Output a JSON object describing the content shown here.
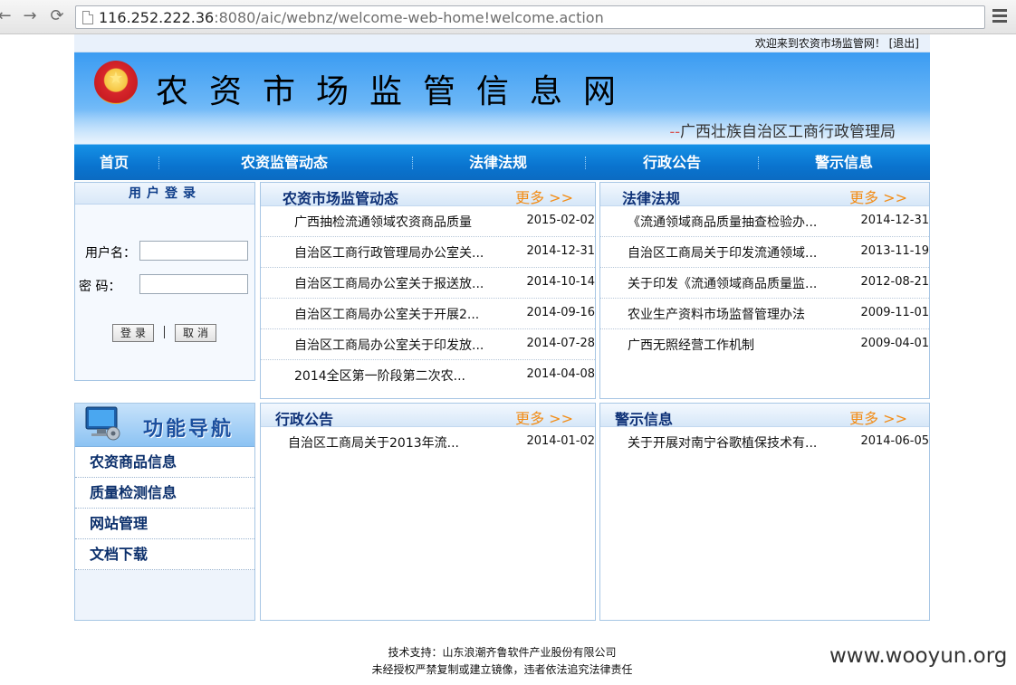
{
  "browser": {
    "back_icon": "←",
    "forward_icon": "→",
    "reload_icon": "⟳",
    "url_host": "116.252.222.36",
    "url_rest": ":8080/aic/webnz/welcome-web-home!welcome.action"
  },
  "header": {
    "welcome": "欢迎来到农资市场监管网！ [退出]",
    "site_title": "农资市场监管信息网",
    "agency_dash": "--",
    "agency": "广西壮族自治区工商行政管理局"
  },
  "nav": {
    "items": [
      "首页",
      "农资监管动态",
      "法律法规",
      "行政公告",
      "警示信息"
    ]
  },
  "login": {
    "title": "用户登录",
    "username_label": "用户名：",
    "password_label": "密    码：",
    "login_button": "登录",
    "cancel_button": "取消"
  },
  "func_nav": {
    "title": "功能导航",
    "items": [
      "农资商品信息",
      "质量检测信息",
      "网站管理",
      "文档下载"
    ]
  },
  "panels": {
    "dynamics": {
      "title": "农资市场监管动态",
      "more": "更多 >>",
      "items": [
        {
          "title": "广西抽检流通领域农资商品质量",
          "date": "2015-02-02"
        },
        {
          "title": "自治区工商行政管理局办公室关...",
          "date": "2014-12-31"
        },
        {
          "title": "自治区工商局办公室关于报送放...",
          "date": "2014-10-14"
        },
        {
          "title": "自治区工商局办公室关于开展2...",
          "date": "2014-09-16"
        },
        {
          "title": "自治区工商局办公室关于印发放...",
          "date": "2014-07-28"
        },
        {
          "title": "2014全区第一阶段第二次农...",
          "date": "2014-04-08"
        }
      ]
    },
    "laws": {
      "title": "法律法规",
      "more": "更多 >>",
      "items": [
        {
          "title": "《流通领域商品质量抽查检验办...",
          "date": "2014-12-31"
        },
        {
          "title": "自治区工商局关于印发流通领域...",
          "date": "2013-11-19"
        },
        {
          "title": "关于印发《流通领域商品质量监...",
          "date": "2012-08-21"
        },
        {
          "title": "农业生产资料市场监督管理办法",
          "date": "2009-11-01"
        },
        {
          "title": "广西无照经营工作机制",
          "date": "2009-04-01"
        }
      ]
    },
    "notices": {
      "title": "行政公告",
      "more": "更多 >>",
      "items": [
        {
          "title": "自治区工商局关于2013年流...",
          "date": "2014-01-02"
        }
      ]
    },
    "warnings": {
      "title": "警示信息",
      "more": "更多 >>",
      "items": [
        {
          "title": "关于开展对南宁谷歌植保技术有...",
          "date": "2014-06-05"
        }
      ]
    }
  },
  "footer": {
    "line1": "技术支持：山东浪潮齐鲁软件产业股份有限公司",
    "line2": "未经授权严禁复制或建立镜像，违者依法追究法律责任"
  },
  "watermark": "www.wooyun.org",
  "colors": {
    "nav_bar": "#0a74cf",
    "more_link": "#f28c16",
    "panel_title": "#0e3177"
  }
}
